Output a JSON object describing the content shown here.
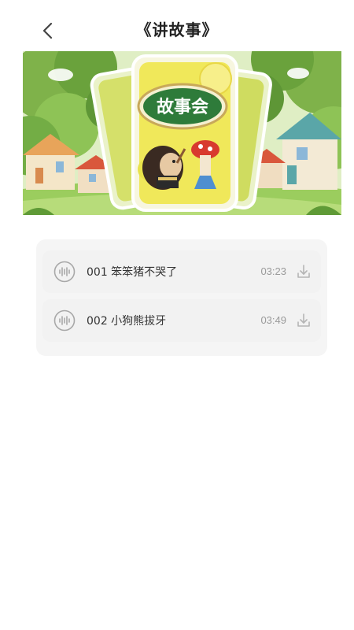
{
  "header": {
    "title": "《讲故事》",
    "back_icon": "chevron-left-icon"
  },
  "banner": {
    "title_text": "故事会",
    "description_icon": "storybook-illustration"
  },
  "stories": [
    {
      "title": "001 笨笨猪不哭了",
      "duration": "03:23",
      "icon": "sound-wave-icon",
      "action_icon": "download-icon"
    },
    {
      "title": "002 小狗熊拔牙",
      "duration": "03:49",
      "icon": "sound-wave-icon",
      "action_icon": "download-icon"
    }
  ],
  "colors": {
    "card_bg": "#f5f5f5",
    "item_bg": "#f2f2f2",
    "title_text": "#333333",
    "duration_text": "#9a9a9a",
    "banner_accent": "#e8e24a"
  }
}
